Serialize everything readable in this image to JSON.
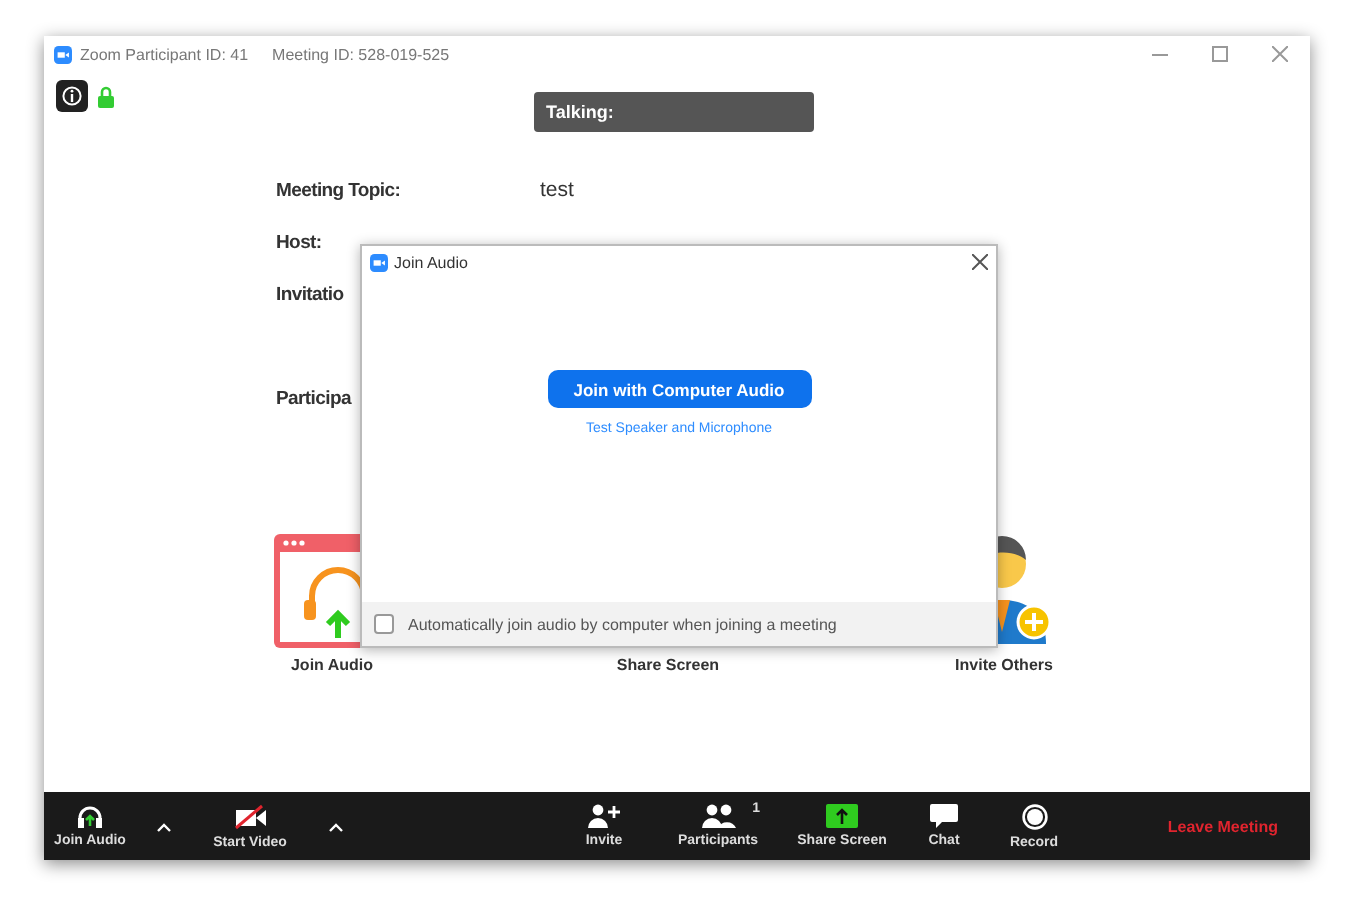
{
  "title_bar": {
    "participant_id": "Zoom Participant ID: 41",
    "meeting_id": "Meeting ID: 528-019-525"
  },
  "talking": "Talking:",
  "meeting_info": [
    {
      "label": "Meeting Topic:",
      "value": "test"
    },
    {
      "label": "Host:"
    },
    {
      "label": "Invitatio"
    },
    {
      "label": "Participa"
    }
  ],
  "actions": [
    {
      "label": "Join Audio",
      "kind": "join_audio"
    },
    {
      "label": "Share Screen",
      "kind": "share_screen"
    },
    {
      "label": "Invite Others",
      "kind": "invite"
    }
  ],
  "dialog": {
    "title": "Join Audio",
    "primary_button": "Join with Computer Audio",
    "link": "Test Speaker and Microphone",
    "auto_join": {
      "label": "Automatically join audio by computer when joining a meeting",
      "checked": false
    }
  },
  "toolbar": {
    "left": [
      {
        "label": "Join Audio",
        "kind": "audio"
      },
      {
        "label": "Start Video",
        "kind": "video"
      }
    ],
    "center": [
      {
        "label": "Invite",
        "kind": "invite"
      },
      {
        "label": "Participants",
        "kind": "participants",
        "count": "1"
      },
      {
        "label": "Share Screen",
        "kind": "share"
      },
      {
        "label": "Chat",
        "kind": "chat"
      },
      {
        "label": "Record",
        "kind": "record"
      }
    ],
    "leave": "Leave Meeting"
  }
}
